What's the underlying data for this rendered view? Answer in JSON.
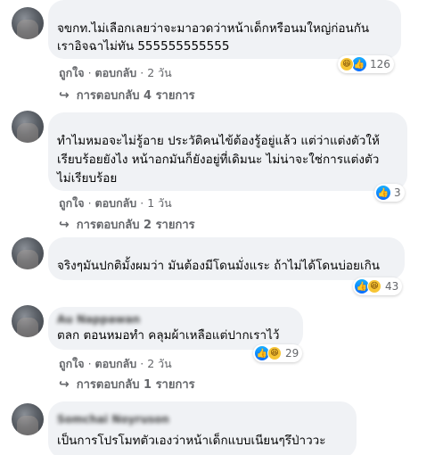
{
  "comments": [
    {
      "author": "",
      "text": "จขกท.ไม่เลือกเลยว่าจะมาอวดว่าหน้าเด็กหรือนมใหญ่ก่อนกัน\nเราอิจฉาไม่ทัน 555555555555",
      "reactions": [
        "haha",
        "like"
      ],
      "reaction_count": "126",
      "like_label": "ถูกใจ",
      "reply_label": "ตอบกลับ",
      "time": "2 วัน",
      "replies_label": "การตอบกลับ 4 รายการ"
    },
    {
      "author": "",
      "text": "ทำไมหมอจะไม่รู้อาย ประวัติคนไข้ต้องรู้อยู่แล้ว แต่ว่าแต่งตัวให้\nเรียบร้อยยังไง หน้าอกมันก็ยังอยู่ที่เดิมนะ ไม่น่าจะใช่การแต่งตัว\nไม่เรียบร้อย",
      "reactions": [
        "like"
      ],
      "reaction_count": "3",
      "like_label": "ถูกใจ",
      "reply_label": "ตอบกลับ",
      "time": "1 วัน",
      "replies_label": "การตอบกลับ 2 รายการ"
    },
    {
      "author": "",
      "text": "จริงๆมันปกติมั้งผมว่า มันต้องมีโดนมั่งแระ ถ้าไม่ได้โดนบ่อยเกิน",
      "reactions": [
        "like",
        "haha"
      ],
      "reaction_count": "43"
    },
    {
      "author": "Au Nappawan",
      "text": "ตลก ตอนหมอทำ คลุมผ้าเหลือแต่ปากเราไว้",
      "reactions": [
        "like",
        "haha"
      ],
      "reaction_count": "29",
      "like_label": "ถูกใจ",
      "reply_label": "ตอบกลับ",
      "time": "2 วัน",
      "replies_label": "การตอบกลับ 1 รายการ"
    },
    {
      "author": "Somchai Noyruson",
      "text": "เป็นการโปรโมทตัวเองว่าหน้าเด็กแบบเนียนๆรึป่าววะ"
    }
  ]
}
